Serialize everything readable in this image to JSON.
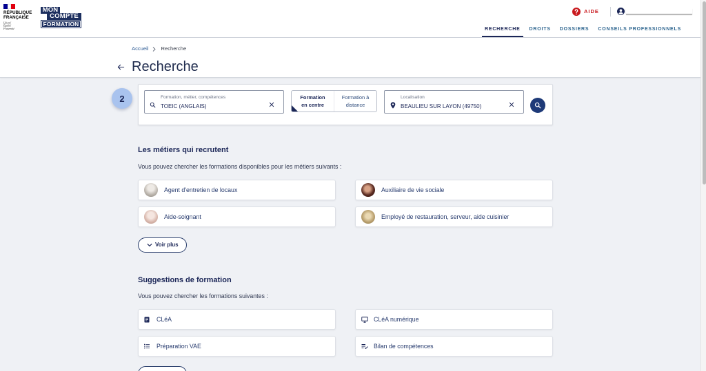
{
  "header": {
    "republique": {
      "line1": "RÉPUBLIQUE",
      "line2": "FRANÇAISE",
      "motto": [
        "Liberté",
        "Égalité",
        "Fraternité"
      ]
    },
    "brand": {
      "line1": "MON",
      "line2": "COMPTE",
      "line3": "FORMATION"
    },
    "help_label": "AIDE",
    "help_icon": "help-circle-icon",
    "user_icon": "account-circle-icon",
    "nav": [
      {
        "label": "RECHERCHE",
        "active": true
      },
      {
        "label": "DROITS",
        "active": false
      },
      {
        "label": "DOSSIERS",
        "active": false
      },
      {
        "label": "CONSEILS PROFESSIONNELS",
        "active": false
      }
    ]
  },
  "breadcrumb": {
    "home": "Accueil",
    "current": "Recherche"
  },
  "page_title": "Recherche",
  "step_badge": "2",
  "search": {
    "query": {
      "label": "Formation, métier, compétences",
      "value": "TOEIC (ANGLAIS)",
      "icon": "search-icon"
    },
    "mode": {
      "options": [
        {
          "line1": "Formation",
          "line2": "en centre",
          "selected": true
        },
        {
          "line1": "Formation à",
          "line2": "distance",
          "selected": false
        }
      ]
    },
    "location": {
      "label": "Localisation",
      "value": "BEAULIEU SUR LAYON (49750)",
      "icon": "location-pin-icon"
    },
    "submit_icon": "search-icon"
  },
  "jobs": {
    "title": "Les métiers qui recrutent",
    "intro": "Vous pouvez chercher les formations disponibles pour les métiers suivants :",
    "items": [
      {
        "label": "Agent d'entretien de locaux"
      },
      {
        "label": "Auxiliaire de vie sociale"
      },
      {
        "label": "Aide-soignant"
      },
      {
        "label": "Employé de restauration, serveur, aide cuisinier"
      }
    ],
    "more_label": "Voir plus"
  },
  "suggestions": {
    "title": "Suggestions de formation",
    "intro": "Vous pouvez chercher les formations suivantes :",
    "items": [
      {
        "label": "CLéA",
        "icon": "document-icon"
      },
      {
        "label": "CLéA numérique",
        "icon": "monitor-icon"
      },
      {
        "label": "Préparation VAE",
        "icon": "list-icon"
      },
      {
        "label": "Bilan de compétences",
        "icon": "checklist-icon"
      }
    ]
  },
  "colors": {
    "navy": "#1b2657",
    "accent_red": "#c9191e",
    "page_bg": "#eff1f5",
    "search_button": "#1e3a78",
    "step_badge": "#a9c3ee"
  }
}
